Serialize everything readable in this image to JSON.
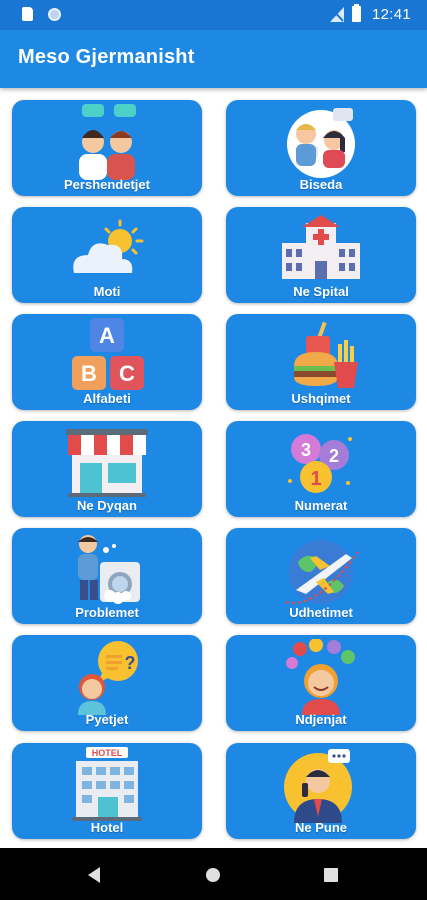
{
  "status_bar": {
    "time": "12:41"
  },
  "app_bar": {
    "title": "Meso Gjermanisht"
  },
  "categories": [
    {
      "label": "Pershendetjet",
      "icon": "greeting-people-icon"
    },
    {
      "label": "Biseda",
      "icon": "conversation-icon"
    },
    {
      "label": "Moti",
      "icon": "weather-icon"
    },
    {
      "label": "Ne Spital",
      "icon": "hospital-icon"
    },
    {
      "label": "Alfabeti",
      "icon": "abc-blocks-icon"
    },
    {
      "label": "Ushqimet",
      "icon": "fast-food-icon"
    },
    {
      "label": "Ne Dyqan",
      "icon": "shop-icon"
    },
    {
      "label": "Numerat",
      "icon": "number-balloons-icon"
    },
    {
      "label": "Problemet",
      "icon": "washing-machine-problem-icon"
    },
    {
      "label": "Udhetimet",
      "icon": "airplane-globe-icon"
    },
    {
      "label": "Pyetjet",
      "icon": "question-bubble-icon"
    },
    {
      "label": "Ndjenjat",
      "icon": "emotions-icon"
    },
    {
      "label": "Hotel",
      "icon": "hotel-building-icon"
    },
    {
      "label": "Ne Pune",
      "icon": "businessman-phone-icon"
    }
  ],
  "colors": {
    "status_bar": "#1976d2",
    "app_bar": "#1e88e5",
    "card": "#1e88e5",
    "nav_bar": "#000000"
  }
}
